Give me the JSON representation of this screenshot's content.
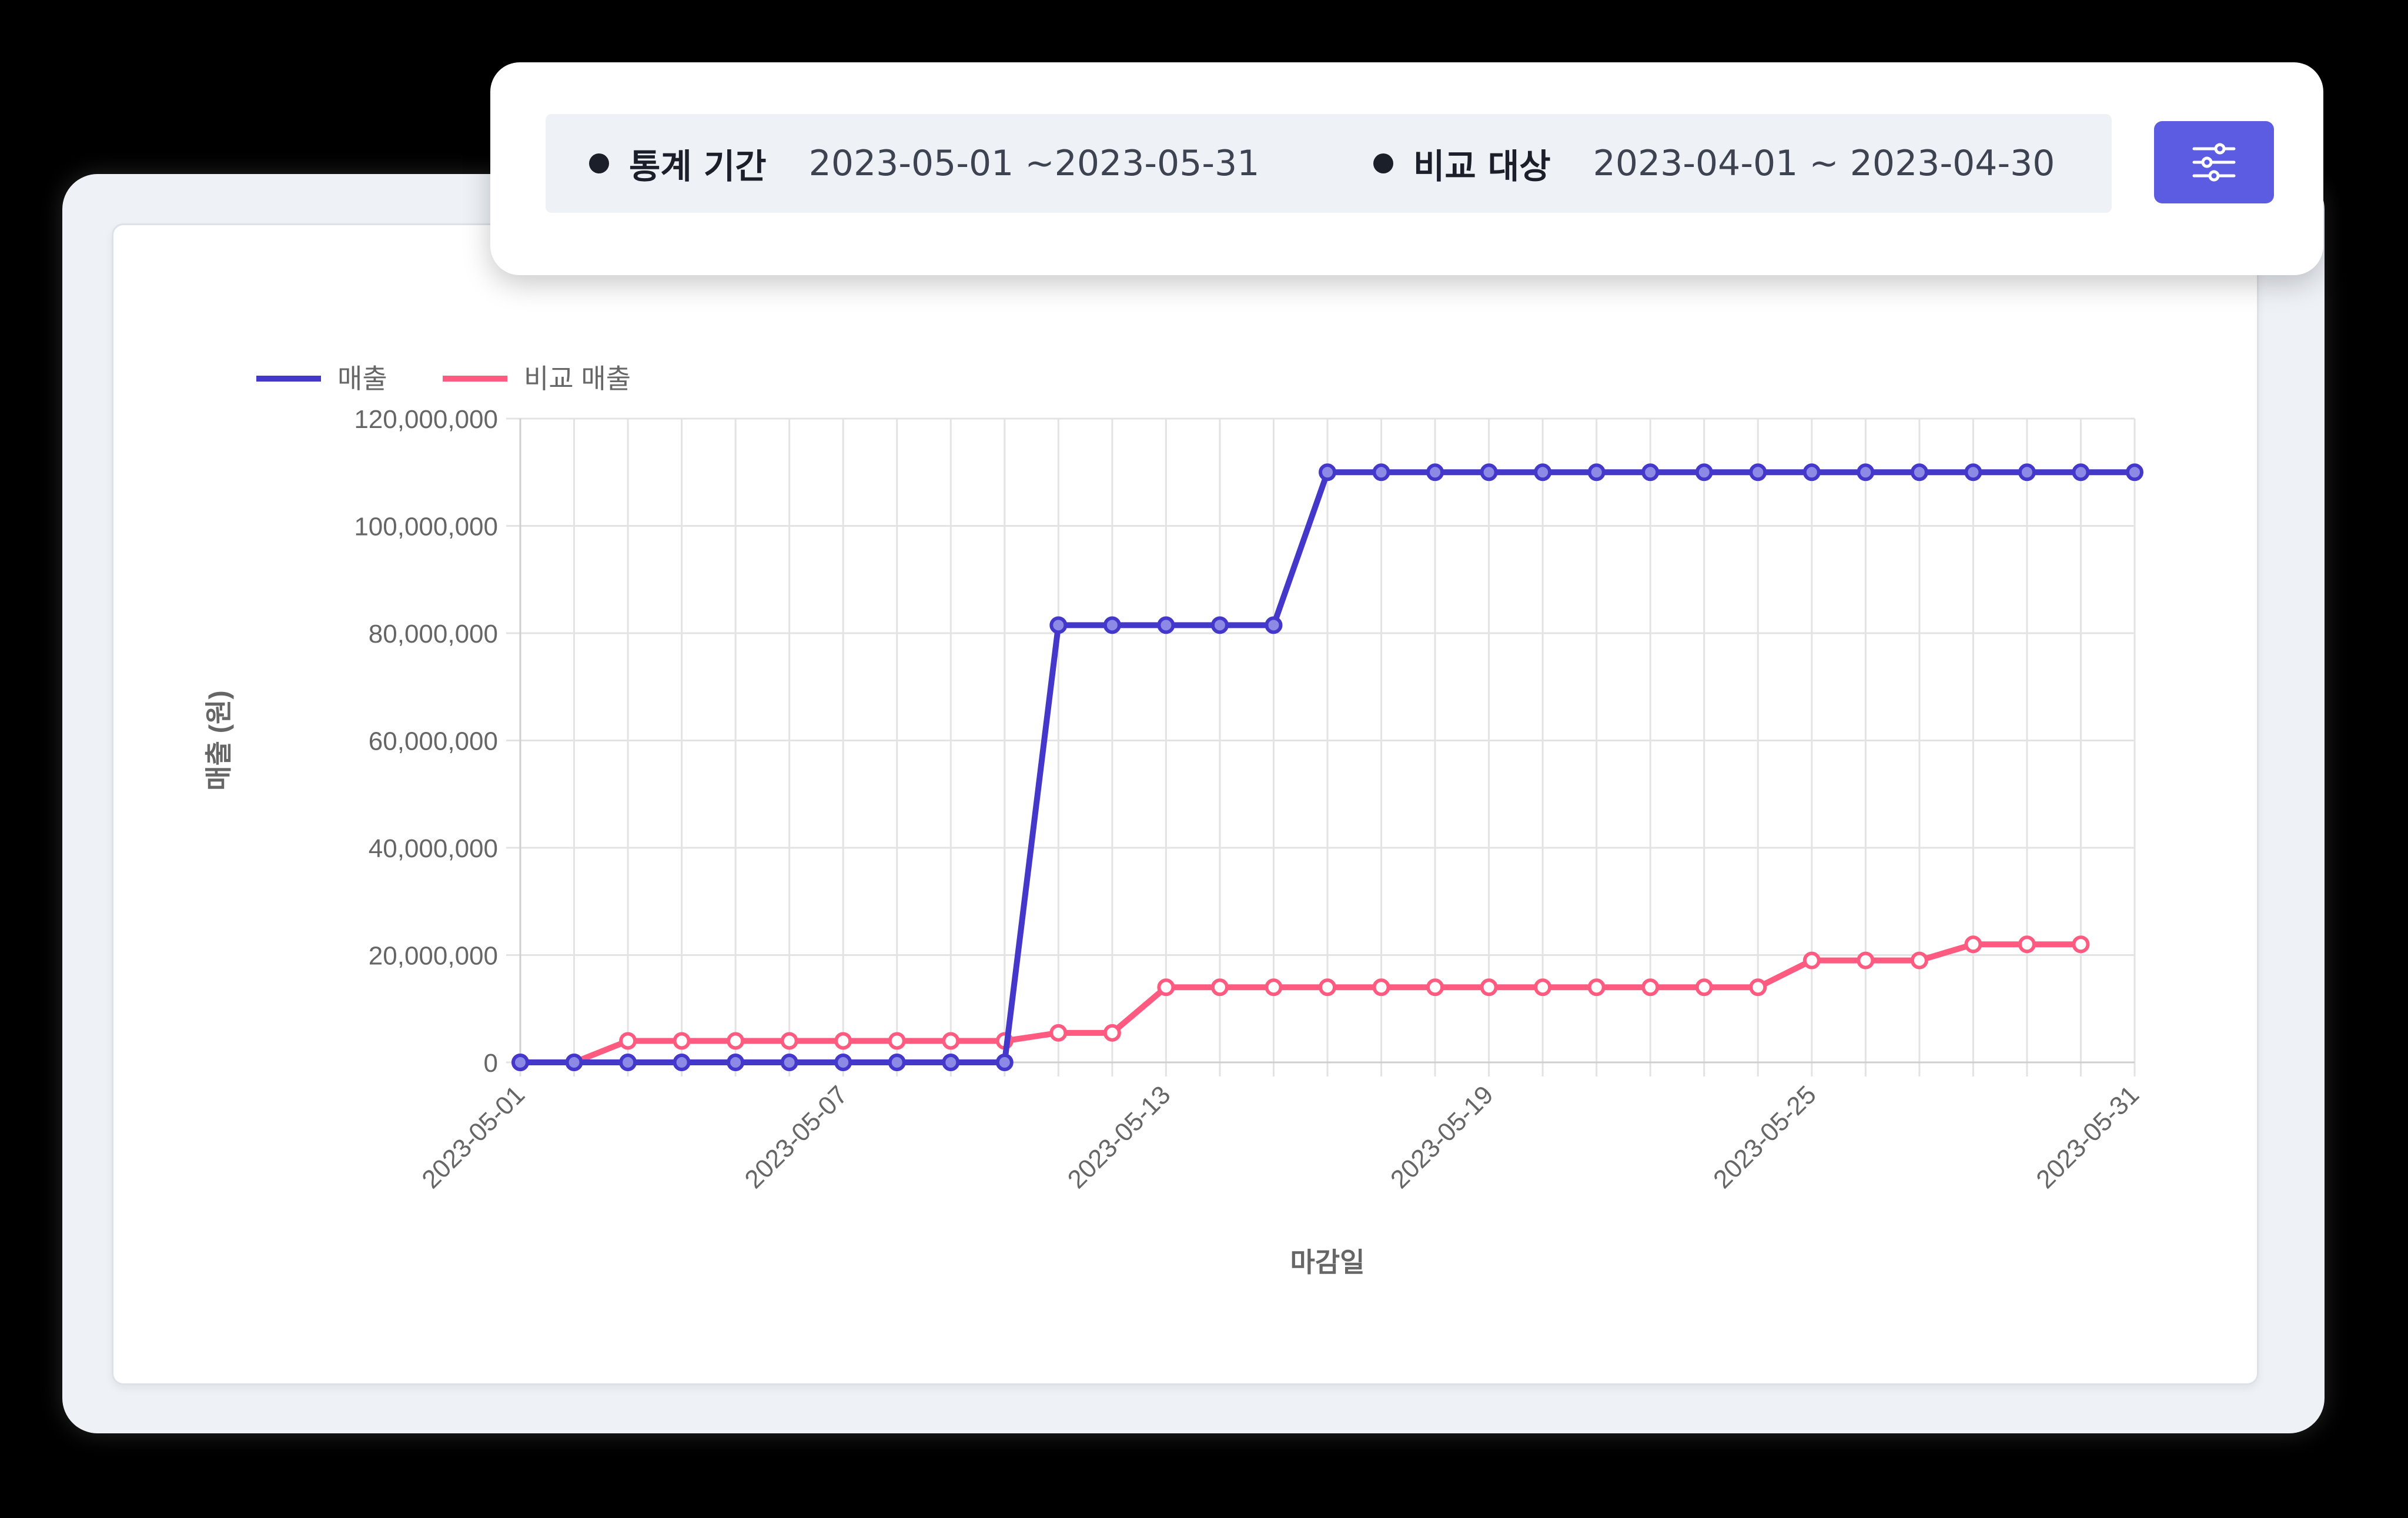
{
  "filter": {
    "period_label": "통계 기간",
    "period_value": "2023-05-01 ~2023-05-31",
    "compare_label": "비교 대상",
    "compare_value": "2023-04-01 ~ 2023-04-30",
    "settings_icon": "sliders-icon"
  },
  "colors": {
    "sales": "#4338ca",
    "compare": "#ff5b80",
    "accent_button": "#5b5ce2"
  },
  "chart_data": {
    "type": "line",
    "title": "",
    "xlabel": "마감일",
    "ylabel": "매출 (원)",
    "ylim": [
      0,
      120000000
    ],
    "y_ticks": [
      0,
      20000000,
      40000000,
      60000000,
      80000000,
      100000000,
      120000000
    ],
    "y_tick_labels": [
      "0",
      "20,000,000",
      "40,000,000",
      "60,000,000",
      "80,000,000",
      "100,000,000",
      "120,000,000"
    ],
    "categories": [
      "2023-05-01",
      "2023-05-02",
      "2023-05-03",
      "2023-05-04",
      "2023-05-05",
      "2023-05-06",
      "2023-05-07",
      "2023-05-08",
      "2023-05-09",
      "2023-05-10",
      "2023-05-11",
      "2023-05-12",
      "2023-05-13",
      "2023-05-14",
      "2023-05-15",
      "2023-05-16",
      "2023-05-17",
      "2023-05-18",
      "2023-05-19",
      "2023-05-20",
      "2023-05-21",
      "2023-05-22",
      "2023-05-23",
      "2023-05-24",
      "2023-05-25",
      "2023-05-26",
      "2023-05-27",
      "2023-05-28",
      "2023-05-29",
      "2023-05-30",
      "2023-05-31"
    ],
    "x_tick_labels": [
      "2023-05-01",
      "2023-05-07",
      "2023-05-13",
      "2023-05-19",
      "2023-05-25",
      "2023-05-31"
    ],
    "grid": true,
    "legend_position": "top-left",
    "series": [
      {
        "name": "매출",
        "color": "#4338ca",
        "values": [
          0,
          0,
          0,
          0,
          0,
          0,
          0,
          0,
          0,
          0,
          81500000,
          81500000,
          81500000,
          81500000,
          81500000,
          110000000,
          110000000,
          110000000,
          110000000,
          110000000,
          110000000,
          110000000,
          110000000,
          110000000,
          110000000,
          110000000,
          110000000,
          110000000,
          110000000,
          110000000,
          110000000
        ]
      },
      {
        "name": "비교 매출",
        "color": "#ff5b80",
        "values": [
          0,
          0,
          4000000,
          4000000,
          4000000,
          4000000,
          4000000,
          4000000,
          4000000,
          4000000,
          5500000,
          5500000,
          14000000,
          14000000,
          14000000,
          14000000,
          14000000,
          14000000,
          14000000,
          14000000,
          14000000,
          14000000,
          14000000,
          14000000,
          19000000,
          19000000,
          19000000,
          22000000,
          22000000,
          22000000
        ]
      }
    ]
  }
}
